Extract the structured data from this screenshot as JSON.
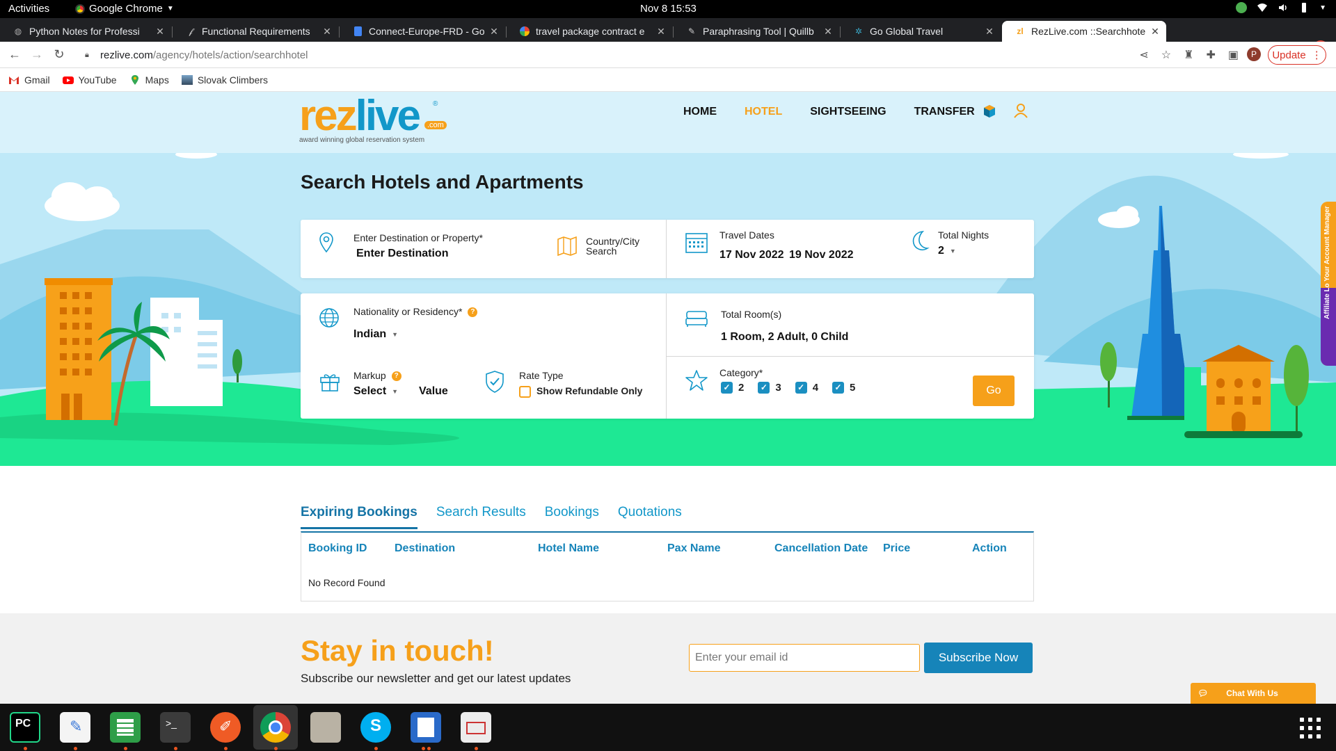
{
  "system_bar": {
    "activities": "Activities",
    "app_name": "Google Chrome",
    "clock": "Nov 8  15:53"
  },
  "browser": {
    "tabs": [
      {
        "title": "Python Notes for Professi",
        "icon": "globe-icon"
      },
      {
        "title": "Functional Requirements",
        "icon": "notion-icon"
      },
      {
        "title": "Connect-Europe-FRD - Go",
        "icon": "docs-icon"
      },
      {
        "title": "travel package contract e",
        "icon": "google-icon"
      },
      {
        "title": "Paraphrasing Tool | Quillb",
        "icon": "quillbot-icon"
      },
      {
        "title": "Go Global Travel",
        "icon": "gear-icon"
      },
      {
        "title": "RezLive.com ::Searchhote",
        "icon": "rezlive-icon",
        "active": true
      }
    ],
    "url_host": "rezlive.com",
    "url_path": "/agency/hotels/action/searchhotel",
    "profile_initial": "P",
    "update_label": "Update",
    "bookmarks": [
      {
        "label": "Gmail",
        "icon": "gmail-icon",
        "color": "#d93025"
      },
      {
        "label": "YouTube",
        "icon": "youtube-icon",
        "color": "#ff0000"
      },
      {
        "label": "Maps",
        "icon": "maps-icon",
        "color": "#34a853"
      },
      {
        "label": "Slovak Climbers",
        "icon": "image-icon",
        "color": "#5a6b7a"
      }
    ]
  },
  "site": {
    "logo_rez": "rez",
    "logo_live": "live",
    "logo_com": ".com",
    "logo_reg": "®",
    "tagline": "award winning global reservation system",
    "nav": [
      "HOME",
      "HOTEL",
      "SIGHTSEEING",
      "TRANSFER"
    ],
    "nav_active": "HOTEL"
  },
  "search": {
    "title": "Search Hotels and Apartments",
    "destination_label": "Enter Destination or Property*",
    "destination_value": "Enter Destination",
    "country_city_label_1": "Country/City",
    "country_city_label_2": "Search",
    "travel_dates_label": "Travel Dates",
    "check_in": "17 Nov 2022",
    "check_out": "19 Nov 2022",
    "total_nights_label": "Total Nights",
    "total_nights_value": "2",
    "nationality_label": "Nationality or Residency*",
    "nationality_value": "Indian",
    "rooms_label": "Total Room(s)",
    "rooms_value": "1 Room, 2 Adult, 0 Child",
    "markup_label": "Markup",
    "markup_select": "Select",
    "markup_value": "Value",
    "rate_type_label": "Rate Type",
    "refundable_label": "Show Refundable Only",
    "refundable_checked": false,
    "category_label": "Category*",
    "categories": [
      {
        "label": "2",
        "checked": true
      },
      {
        "label": "3",
        "checked": true
      },
      {
        "label": "4",
        "checked": true
      },
      {
        "label": "5",
        "checked": true
      }
    ],
    "help_mark": "?",
    "go_label": "Go"
  },
  "bookings": {
    "tabs": [
      "Expiring Bookings",
      "Search Results",
      "Bookings",
      "Quotations"
    ],
    "active_tab": "Expiring Bookings",
    "columns": [
      "Booking ID",
      "Destination",
      "Hotel Name",
      "Pax Name",
      "Cancellation Date",
      "Price",
      "Action"
    ],
    "empty_message": "No Record Found"
  },
  "newsletter": {
    "heading": "Stay in touch!",
    "subheading": "Subscribe our newsletter and get our latest updates",
    "email_placeholder": "Enter your email id",
    "subscribe_label": "Subscribe Now"
  },
  "widgets": {
    "chat_label": "Chat With Us",
    "side_tab_label": "Affiliate Lo   Your Account Manager"
  },
  "colors": {
    "brand_orange": "#f6a01a",
    "brand_blue": "#1297c9",
    "hero_sky": "#bfe9f8",
    "hero_grass": "#1ee894"
  },
  "dock_apps": [
    "pycharm-icon",
    "text-editor-icon",
    "spreadsheet-icon",
    "terminal-icon",
    "postman-icon",
    "chrome-icon",
    "files-icon",
    "skype-icon",
    "document-viewer-icon",
    "screenshot-icon"
  ]
}
